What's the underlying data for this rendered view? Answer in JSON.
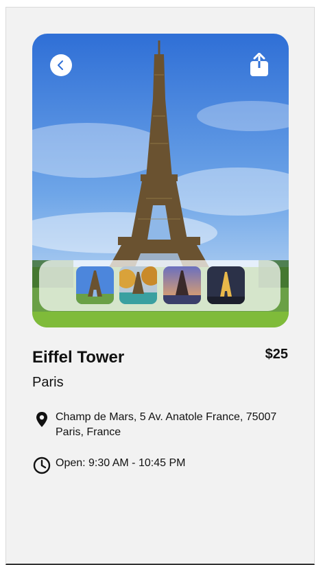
{
  "place": {
    "name": "Eiffel Tower",
    "price": "$25",
    "city": "Paris",
    "address": "Champ de Mars, 5 Av. Anatole France, 75007 Paris, France",
    "hours": "Open: 9:30 AM - 10:45 PM"
  },
  "icons": {
    "back": "chevron-left-icon",
    "share": "share-icon",
    "address": "map-pin-icon",
    "hours": "clock-icon"
  },
  "gallery": {
    "thumbnails": [
      "eiffel-day",
      "eiffel-autumn",
      "eiffel-sunset",
      "eiffel-night"
    ]
  },
  "colors": {
    "background": "#f2f2f2",
    "sky": "#3f7fd8",
    "grass": "#5e9a2b",
    "tower": "#6a5230"
  }
}
